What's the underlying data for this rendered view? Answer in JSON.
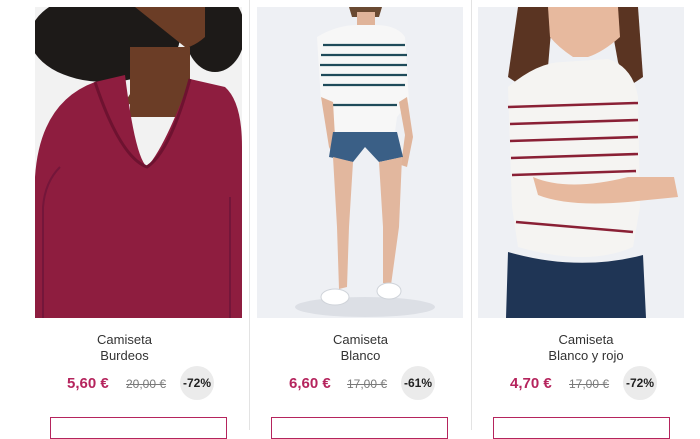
{
  "products": [
    {
      "title": "Camiseta",
      "color": "Burdeos",
      "price": "5,60 €",
      "old_price": "20,00 €",
      "discount": "-72%",
      "image_icon": "burgundy-tshirt-photo"
    },
    {
      "title": "Camiseta",
      "color": "Blanco",
      "price": "6,60 €",
      "old_price": "17,00 €",
      "discount": "-61%",
      "image_icon": "white-striped-tshirt-photo"
    },
    {
      "title": "Camiseta",
      "color": "Blanco y rojo",
      "price": "4,70 €",
      "old_price": "17,00 €",
      "discount": "-72%",
      "image_icon": "white-red-striped-tshirt-photo"
    }
  ],
  "colors": {
    "accent": "#b5245d",
    "burgundy": "#8e1d3f",
    "navy_stripe": "#1f4b5a",
    "red_stripe": "#8a2035"
  }
}
